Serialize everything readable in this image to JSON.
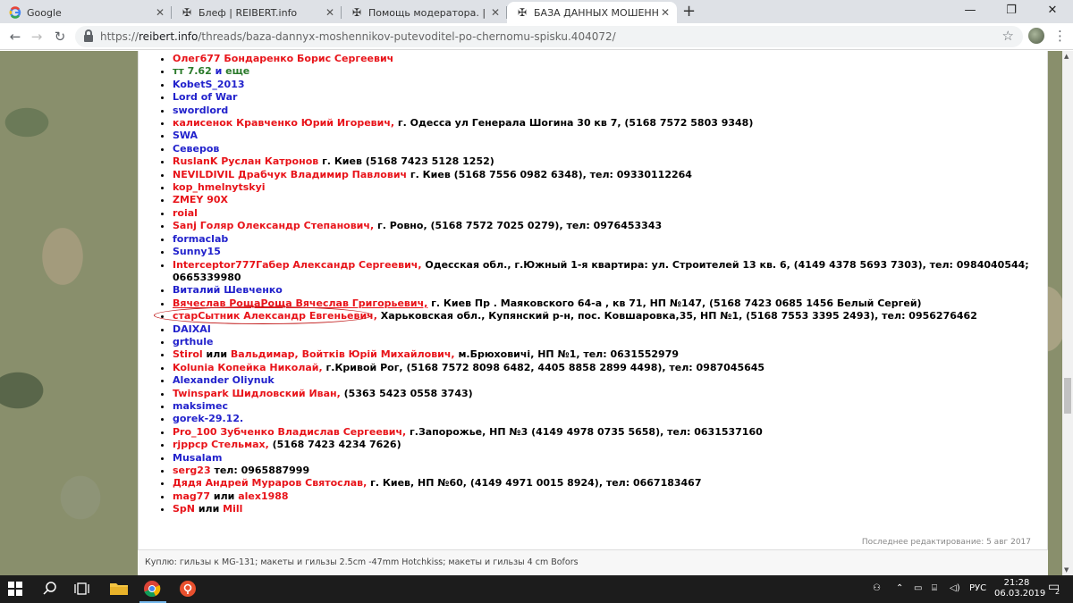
{
  "browser": {
    "tabs": [
      {
        "title": "Google",
        "icon": "google-icon",
        "active": false
      },
      {
        "title": "Блеф | REIBERT.info",
        "icon": "reibert-cross-icon",
        "active": false
      },
      {
        "title": "Помощь модератора. | REIBERT.info",
        "icon": "reibert-cross-icon",
        "active": false
      },
      {
        "title": "БАЗА ДАННЫХ МОШЕННИКОВ",
        "icon": "reibert-cross-icon",
        "active": true
      }
    ],
    "new_tab_symbol": "+",
    "url_prefix": "https://",
    "url_host": "reibert.info",
    "url_path": "/threads/baza-dannyx-moshennikov-putevoditel-po-chernomu-spisku.404072/"
  },
  "entries": [
    {
      "parts": [
        {
          "t": "Олег677 Бондаренко Борис Сергеевич",
          "c": "red"
        }
      ]
    },
    {
      "parts": [
        {
          "t": "тт 7.62 ",
          "c": "green"
        },
        {
          "t": "и",
          "c": "blue"
        },
        {
          "t": " еще",
          "c": "green"
        }
      ]
    },
    {
      "parts": [
        {
          "t": "KobetS_2013",
          "c": "blue"
        }
      ]
    },
    {
      "parts": [
        {
          "t": "Lord of War",
          "c": "blue"
        }
      ]
    },
    {
      "parts": [
        {
          "t": "swordlord",
          "c": "blue"
        }
      ]
    },
    {
      "parts": [
        {
          "t": "калисенок Кравченко Юрий Игоревич,",
          "c": "red"
        },
        {
          "t": " г. Одесса ул Генерала Шогина 30 кв 7, (5168 7572 5803 9348)",
          "c": "black"
        }
      ]
    },
    {
      "parts": [
        {
          "t": "SWA",
          "c": "blue"
        }
      ]
    },
    {
      "parts": [
        {
          "t": "Северов",
          "c": "blue"
        }
      ]
    },
    {
      "parts": [
        {
          "t": "RuslanK Руслан Катронов",
          "c": "red"
        },
        {
          "t": " г. Киев (5168 7423 5128 1252)",
          "c": "black"
        }
      ]
    },
    {
      "parts": [
        {
          "t": "NEVILDIVIL Драбчук Владимир Павлович",
          "c": "red"
        },
        {
          "t": " г. Киев (5168 7556 0982 6348), тел: 09330112264",
          "c": "black"
        }
      ]
    },
    {
      "parts": [
        {
          "t": "kop_hmelnytskyi",
          "c": "red"
        }
      ]
    },
    {
      "parts": [
        {
          "t": "ZMEY 90X",
          "c": "red"
        }
      ]
    },
    {
      "parts": [
        {
          "t": "roial",
          "c": "red"
        }
      ]
    },
    {
      "parts": [
        {
          "t": "Sanj Голяр Олександр Степанович,",
          "c": "red"
        },
        {
          "t": " г. Ровно, (5168 7572 7025 0279), тел: 0976453343",
          "c": "black"
        }
      ]
    },
    {
      "parts": [
        {
          "t": "formaclab",
          "c": "blue"
        }
      ]
    },
    {
      "parts": [
        {
          "t": "Sunny15",
          "c": "blue"
        }
      ]
    },
    {
      "parts": [
        {
          "t": "Interceptor777Габер Александр Сергеевич,",
          "c": "red"
        },
        {
          "t": " Одесская обл., г.Южный 1-я квартира: ул. Строителей 13 кв. 6, (4149 4378 5693 7303), тел: 0984040544; 0665339980",
          "c": "black"
        }
      ]
    },
    {
      "parts": [
        {
          "t": "Виталий Шевченко",
          "c": "blue"
        }
      ]
    },
    {
      "parts": [
        {
          "t": "Вячеслав РощаРоща Вячеслав Григорьевич,",
          "c": "red ul"
        },
        {
          "t": " г. Киев Пр . Маяковского 64-а , кв 71, НП №147, (5168 7423 0685 1456 Белый Сергей)",
          "c": "black"
        }
      ]
    },
    {
      "parts": [
        {
          "t": "старСытник Александр Евгеньевич,",
          "c": "red"
        },
        {
          "t": " Харьковская обл., Купянский р-н, пос. Ковшаровка,35, НП №1, (5168 7553 3395 2493), тел: 0956276462",
          "c": "black"
        }
      ]
    },
    {
      "parts": [
        {
          "t": "DAIXAI",
          "c": "blue"
        }
      ]
    },
    {
      "parts": [
        {
          "t": "grthule",
          "c": "blue"
        }
      ]
    },
    {
      "parts": [
        {
          "t": "Stirol",
          "c": "red"
        },
        {
          "t": " или ",
          "c": "black"
        },
        {
          "t": "Вальдимар, Войтків Юрій Михайлович,",
          "c": "red"
        },
        {
          "t": " м.Брюховичі, НП №1, тел: 0631552979",
          "c": "black"
        }
      ]
    },
    {
      "parts": [
        {
          "t": "Kolunia Копейка Николай,",
          "c": "red"
        },
        {
          "t": " г.Кривой Рог, (5168 7572 8098 6482, 4405 8858 2899 4498), тел: 0987045645",
          "c": "black"
        }
      ]
    },
    {
      "parts": [
        {
          "t": "Alexander Oliynuk",
          "c": "blue"
        }
      ]
    },
    {
      "parts": [
        {
          "t": "Twinspark Шидловский Иван,",
          "c": "red"
        },
        {
          "t": " (5363 5423 0558 3743)",
          "c": "black"
        }
      ]
    },
    {
      "parts": [
        {
          "t": "maksimec",
          "c": "blue"
        }
      ]
    },
    {
      "parts": [
        {
          "t": "gorek-29.12.",
          "c": "blue"
        }
      ]
    },
    {
      "parts": [
        {
          "t": "Pro_100 Зубченко Владислав Сергеевич,",
          "c": "red"
        },
        {
          "t": " г.Запорожье, НП №3 (4149 4978 0735 5658), тел: 0631537160",
          "c": "black"
        }
      ]
    },
    {
      "parts": [
        {
          "t": "rjppcp Стельмах,",
          "c": "red"
        },
        {
          "t": " (5168 7423 4234 7626)",
          "c": "black"
        }
      ]
    },
    {
      "parts": [
        {
          "t": "Musalam",
          "c": "blue"
        }
      ]
    },
    {
      "parts": [
        {
          "t": "serg23",
          "c": "red"
        },
        {
          "t": " тел: 0965887999",
          "c": "black"
        }
      ]
    },
    {
      "parts": [
        {
          "t": "Дядя Андрей Мураров Святослав,",
          "c": "red"
        },
        {
          "t": " г. Киев, НП №60, (4149 4971 0015 8924), тел: 0667183467",
          "c": "black"
        }
      ]
    },
    {
      "parts": [
        {
          "t": "mag77",
          "c": "red"
        },
        {
          "t": " или ",
          "c": "black"
        },
        {
          "t": "alex1988",
          "c": "red"
        }
      ]
    },
    {
      "parts": [
        {
          "t": "SpN",
          "c": "red"
        },
        {
          "t": " или ",
          "c": "black"
        },
        {
          "t": "Mill",
          "c": "red"
        }
      ]
    }
  ],
  "post": {
    "last_edited": "Последнее редактирование: 5 авг 2017",
    "signature": "Куплю: гильзы к MG-131; макеты и гильзы 2.5cm -47mm Hotchkiss; макеты и гильзы 4 cm Bofors"
  },
  "taskbar": {
    "lang": "РУС",
    "time": "21:28",
    "date": "06.03.2019",
    "notifications": "2"
  }
}
